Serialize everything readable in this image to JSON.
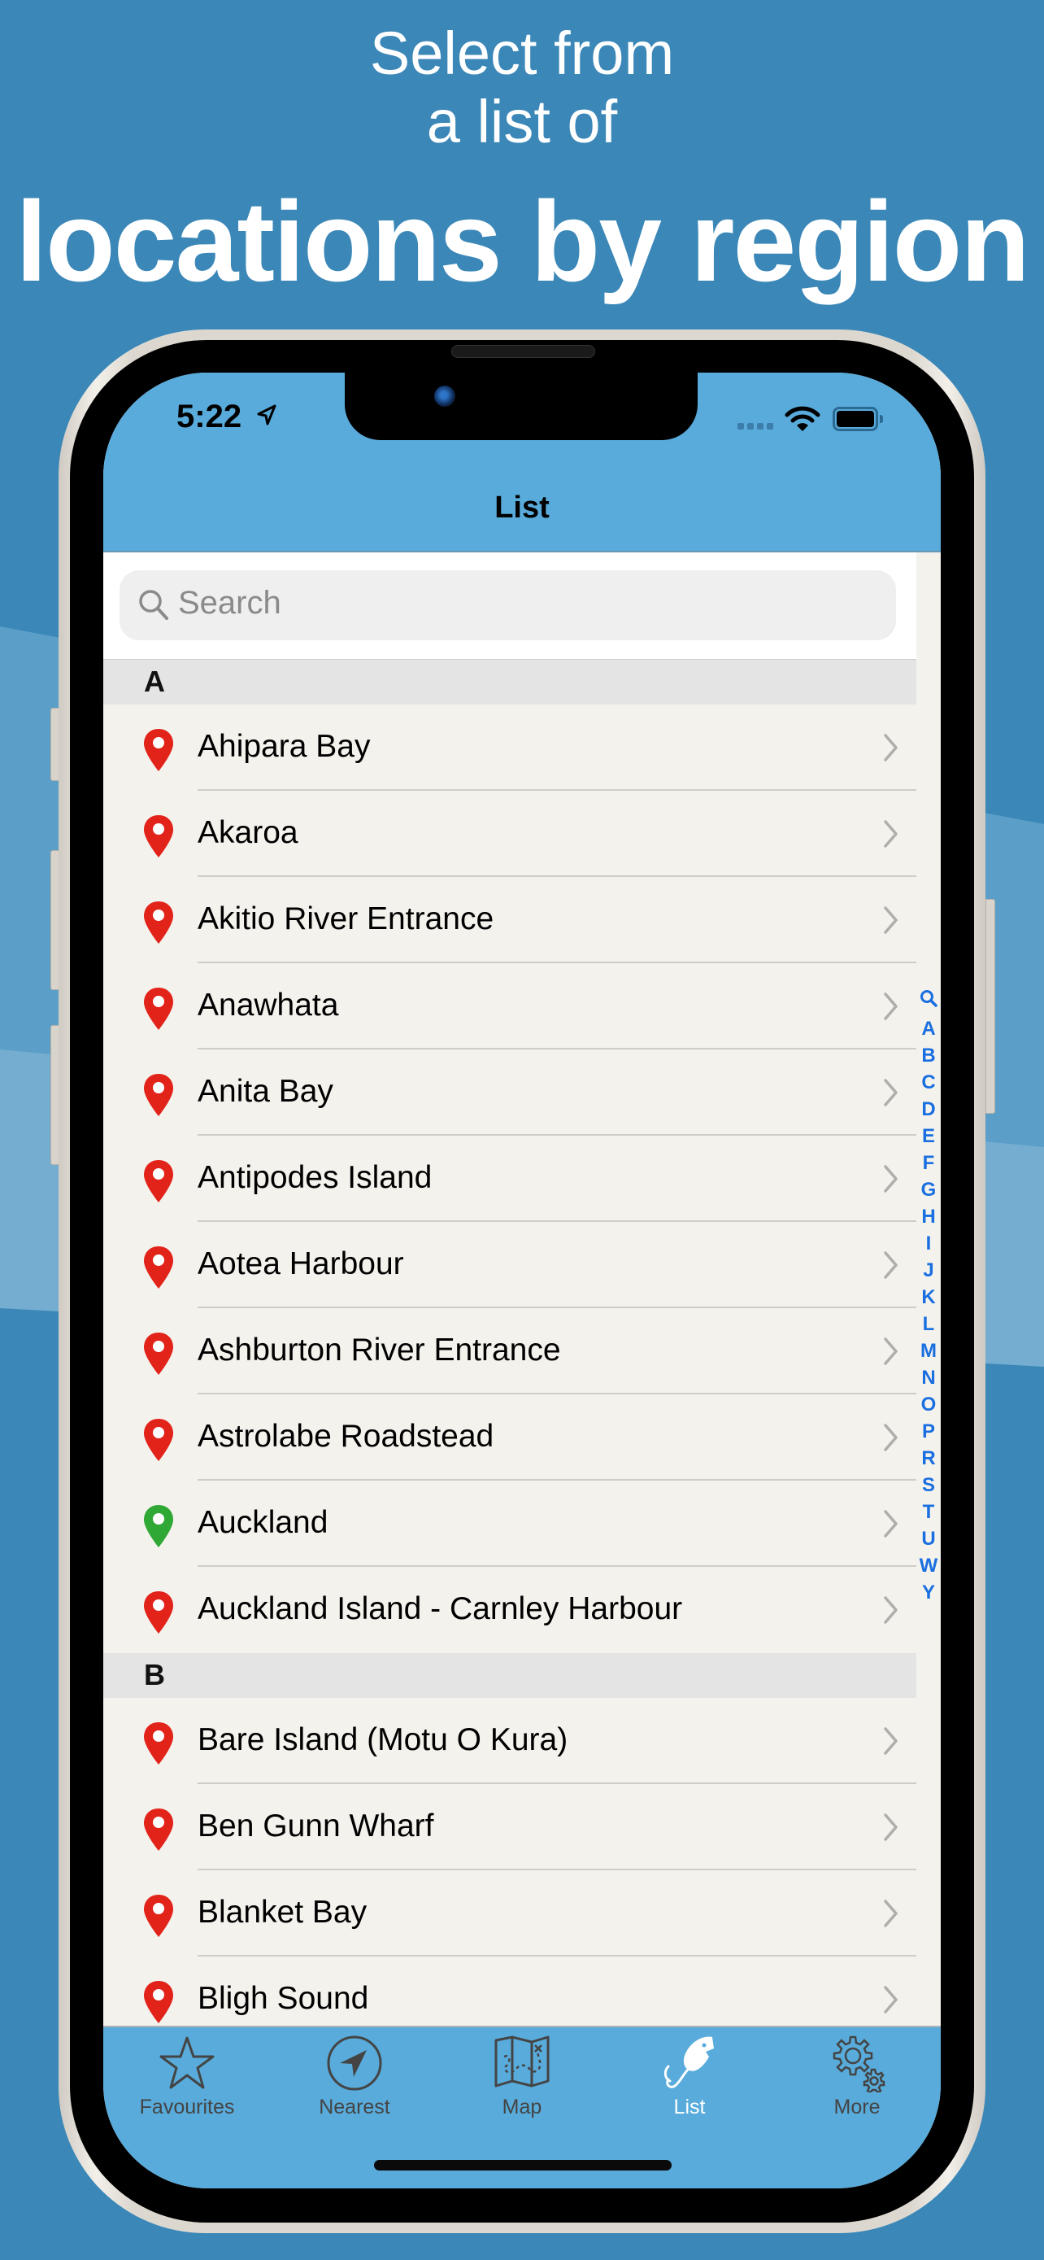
{
  "promo": {
    "line1": "Select from",
    "line2": "a list of",
    "line3": "locations by region"
  },
  "status_bar": {
    "time": "5:22",
    "location_icon": "location-arrow-icon",
    "wifi_icon": "wifi-icon",
    "battery_icon": "battery-icon"
  },
  "nav": {
    "title": "List"
  },
  "search": {
    "placeholder": "Search",
    "value": ""
  },
  "colors": {
    "header_blue": "#58abdb",
    "pin_red": "#e2231a",
    "pin_green": "#2fa836",
    "index_blue": "#1a6fe0",
    "tab_active": "#ffffff",
    "tab_inactive": "#444444"
  },
  "sections": [
    {
      "letter": "A",
      "items": [
        {
          "name": "Ahipara Bay",
          "pin": "red"
        },
        {
          "name": "Akaroa",
          "pin": "red"
        },
        {
          "name": "Akitio River Entrance",
          "pin": "red"
        },
        {
          "name": "Anawhata",
          "pin": "red"
        },
        {
          "name": "Anita Bay",
          "pin": "red"
        },
        {
          "name": "Antipodes Island",
          "pin": "red"
        },
        {
          "name": "Aotea Harbour",
          "pin": "red"
        },
        {
          "name": "Ashburton River Entrance",
          "pin": "red"
        },
        {
          "name": "Astrolabe Roadstead",
          "pin": "red"
        },
        {
          "name": "Auckland",
          "pin": "green"
        },
        {
          "name": "Auckland Island - Carnley Harbour",
          "pin": "red"
        }
      ]
    },
    {
      "letter": "B",
      "items": [
        {
          "name": "Bare Island (Motu O Kura)",
          "pin": "red"
        },
        {
          "name": "Ben Gunn Wharf",
          "pin": "red"
        },
        {
          "name": "Blanket Bay",
          "pin": "red"
        },
        {
          "name": "Bligh Sound",
          "pin": "red"
        }
      ]
    }
  ],
  "index": [
    "search",
    "A",
    "B",
    "C",
    "D",
    "E",
    "F",
    "G",
    "H",
    "I",
    "J",
    "K",
    "L",
    "M",
    "N",
    "O",
    "P",
    "R",
    "S",
    "T",
    "U",
    "W",
    "Y"
  ],
  "tabs": [
    {
      "label": "Favourites",
      "icon": "star-icon",
      "active": false
    },
    {
      "label": "Nearest",
      "icon": "navigation-arrow-icon",
      "active": false
    },
    {
      "label": "Map",
      "icon": "map-icon",
      "active": false
    },
    {
      "label": "List",
      "icon": "fishing-lure-icon",
      "active": true
    },
    {
      "label": "More",
      "icon": "gears-icon",
      "active": false
    }
  ]
}
